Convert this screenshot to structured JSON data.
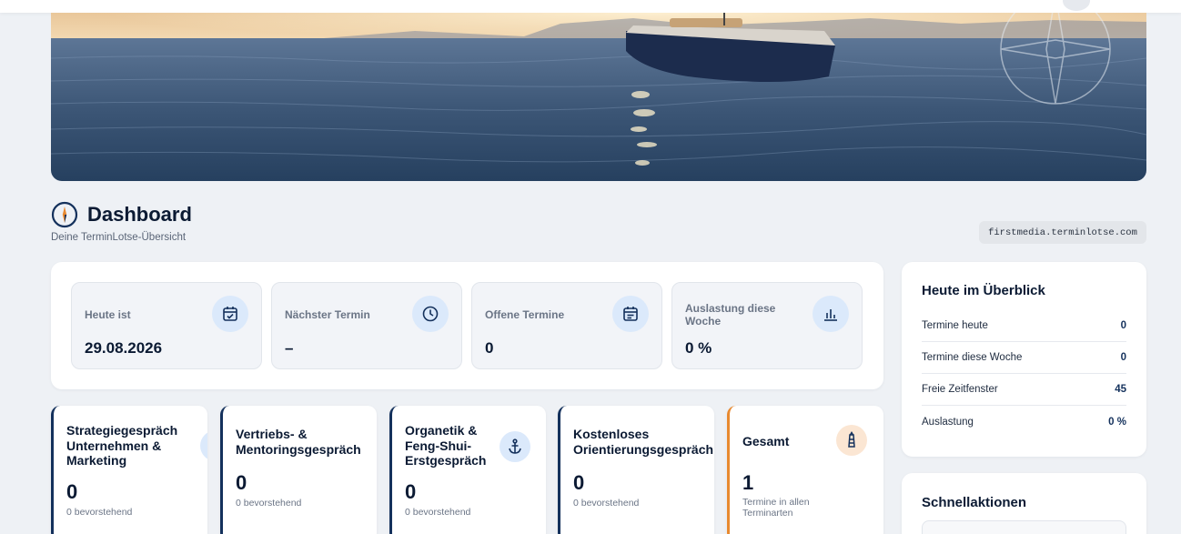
{
  "header": {
    "title": "Dashboard",
    "subtitle": "Deine TerminLotse-Übersicht",
    "domain": "firstmedia.terminlotse.com"
  },
  "stats": [
    {
      "label": "Heute ist",
      "value": "29.08.2026",
      "icon": "calendar-check-icon"
    },
    {
      "label": "Nächster Termin",
      "value": "–",
      "icon": "clock-icon"
    },
    {
      "label": "Offene Termine",
      "value": "0",
      "icon": "calendar-list-icon"
    },
    {
      "label": "Auslastung diese Woche",
      "value": "0 %",
      "icon": "bar-chart-icon"
    }
  ],
  "types": [
    {
      "title": "Strategiegespräch\nUnternehmen &\nMarketing",
      "count": "0",
      "sub": "0 bevorstehend"
    },
    {
      "title": "Vertriebs- &\nMentoringsgespräch",
      "count": "0",
      "sub": "0 bevorstehend"
    },
    {
      "title": "Organetik &\nFeng-Shui-\nErstgespräch",
      "count": "0",
      "sub": "0 bevorstehend",
      "icon": "anchor-icon"
    },
    {
      "title": "Kostenloses\nOrientierungsgespräch",
      "count": "0",
      "sub": "0 bevorstehend"
    },
    {
      "title": "Gesamt",
      "count": "1",
      "sub": "Termine in allen\nTerminarten",
      "icon": "lighthouse-icon"
    }
  ],
  "overview": {
    "title": "Heute im Überblick",
    "rows": [
      {
        "label": "Termine heute",
        "value": "0"
      },
      {
        "label": "Termine diese Woche",
        "value": "0"
      },
      {
        "label": "Freie Zeitfenster",
        "value": "45"
      },
      {
        "label": "Auslastung",
        "value": "0 %"
      }
    ]
  },
  "quick_actions": {
    "title": "Schnellaktionen"
  },
  "colors": {
    "accent_navy": "#14315c",
    "accent_orange": "#e8892f",
    "icon_bg": "#dbe9fb"
  }
}
